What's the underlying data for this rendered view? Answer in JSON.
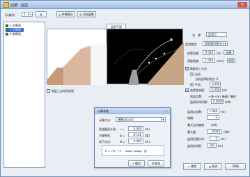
{
  "window": {
    "title": "边坡 - 监控",
    "close_label": "×"
  },
  "toolbar": {
    "label": "号(编号)",
    "combo_value": "1",
    "btn1": "传输情况",
    "btn2": "新增",
    "btn3": "添加层数"
  },
  "tree": {
    "items": [
      "1-主断面",
      "2-主断面",
      "3-副断面"
    ]
  },
  "preview": {
    "tab": "监测平面",
    "checkbox_label": "地层上自动添加到"
  },
  "form": {
    "name_label": "名　称:",
    "name_value": "监测点",
    "type_label": "监测类型:",
    "type_value": "测斜管(倾斜计)",
    "depth_label": "安置深度:",
    "depth_value": "0.000",
    "depth_unit": "(m)",
    "depth_btn": "选择",
    "width_label": "测量宽度:",
    "width_value": "1.000",
    "width_unit": "(m/s)",
    "width_btn": "选项",
    "radio_group": "数据导入方式",
    "radio1": "自动",
    "radio1_sub": "当前选择检测点: 0",
    "radio2": "手动",
    "opt_label": "选择监测值:",
    "opt_value": "0.000",
    "opt_unit": "(m)",
    "line_label": "地层位置:",
    "line_note": "一条一块 / 新增 / 最终",
    "line2_label": "监测时间间隔:",
    "line2_value": "0.0000",
    "line2_unit": "(kN)",
    "cons_label": "监测点总数:",
    "cons_value": "1.000",
    "cons_unit": "(m)",
    "freq_label": "周期:",
    "freq_value": "0",
    "maxv_label": "最大允许偏差:",
    "maxv_value": "(kN)",
    "maxv2_label": "最大值:",
    "maxv2_value": "20000",
    "maxv2_unit": "(kN)",
    "loc_label": "监测位置分布:",
    "loc_value": "0",
    "loc_unit": "(m)",
    "dist_label": "监测点间距:",
    "dist_value": "100",
    "dist_unit": "(m)"
  },
  "dialog": {
    "title": "计算参数",
    "close": "×",
    "method_label": "计算方法:",
    "method_value": "弹簧法(公式)",
    "r1_label": "管道截面半径:",
    "r1_sym": "r =",
    "r1_value": "0.000",
    "r1_unit": "(m)",
    "r2_label": "内摩擦角:",
    "r2_sym": "φ =",
    "r2_value": "87.00",
    "r2_unit": "(度)",
    "r3_label": "地下水位:",
    "r3_sym": "H =",
    "r3_value": "0.000",
    "r3_unit": "(m)",
    "formula": "F = √(η · (1 − sinφ / tanφ) · β)",
    "ok": "确定",
    "cancel": "取消"
  },
  "footer": {
    "ok": "确定",
    "cancel": "取消",
    "help": "?帮助"
  }
}
